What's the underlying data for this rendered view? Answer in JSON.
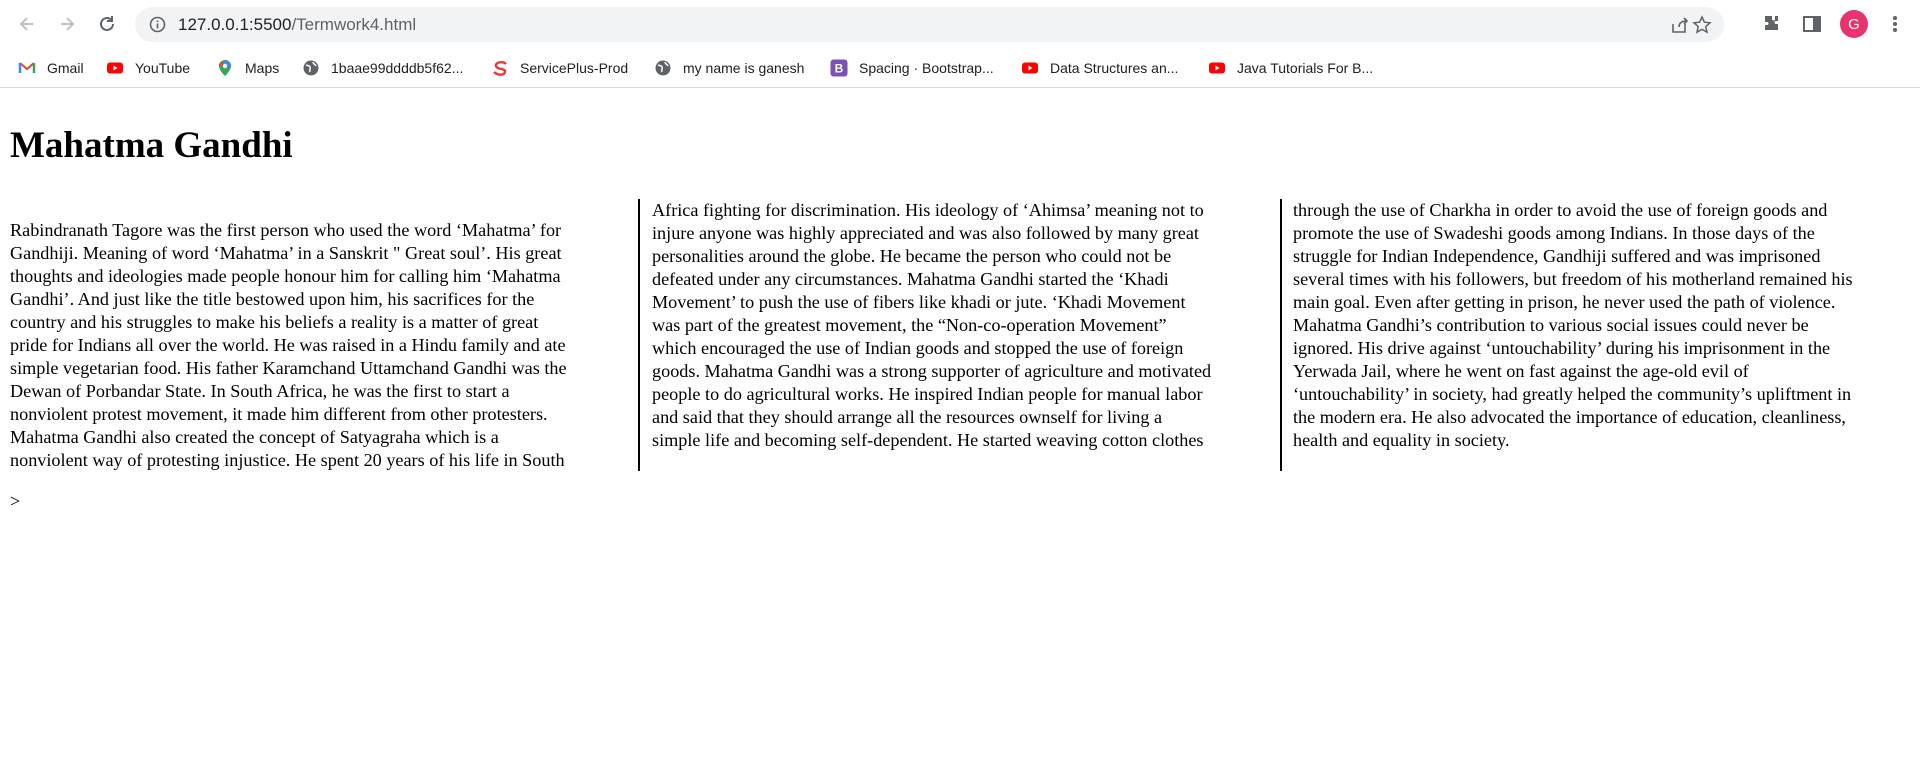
{
  "browser": {
    "url_host": "127.0.0.1:5500",
    "url_path": "/Termwork4.html",
    "avatar_letter": "G",
    "avatar_color": "#e8336d",
    "bookmarks": [
      {
        "label": "Gmail",
        "icon": "gmail-icon"
      },
      {
        "label": "YouTube",
        "icon": "youtube-icon"
      },
      {
        "label": "Maps",
        "icon": "maps-icon"
      },
      {
        "label": "1baae99ddddb5f62...",
        "icon": "globe-icon"
      },
      {
        "label": "ServicePlus-Prod",
        "icon": "serviceplus-icon"
      },
      {
        "label": "my name is ganesh",
        "icon": "globe-icon"
      },
      {
        "label": "Spacing · Bootstrap...",
        "icon": "bootstrap-icon"
      },
      {
        "label": "Data Structures an...",
        "icon": "youtube-icon"
      },
      {
        "label": "Java Tutorials For B...",
        "icon": "youtube-icon"
      }
    ]
  },
  "page": {
    "title": "Mahatma Gandhi",
    "columns": [
      [
        "Rabindranath Tagore was the first person who used the word  ‘Mahatma’ for",
        "Gandhiji. Meaning of word ‘Mahatma’ in a Sanskrit \" Great soul’. His great",
        "thoughts and ideologies made people honour him for calling him ‘Mahatma",
        "Gandhi’. And just like the title bestowed upon him, his sacrifices for the",
        "country and his struggles to make his beliefs a reality is a matter of great",
        "pride for Indians all over the world. He was raised in a Hindu family and ate",
        "simple vegetarian food. His father Karamchand Uttamchand Gandhi was the",
        "Dewan of Porbandar State. In South Africa, he was the first to start a",
        "nonviolent protest movement, it made him different from other protesters.",
        "Mahatma Gandhi also created the concept of Satyagraha which is a",
        "nonviolent way of protesting injustice. He spent 20 years of his life in South"
      ],
      [
        "Africa fighting for discrimination. His ideology of ‘Ahimsa’ meaning not to",
        "injure anyone was highly appreciated and was also followed by many great",
        "personalities around the globe. He became the person who could not be",
        "defeated under any circumstances. Mahatma Gandhi started the ‘Khadi",
        "Movement’ to push the use of fibers like khadi or jute. ‘Khadi Movement",
        "was part of the greatest movement, the “Non-co-operation Movement”",
        "which encouraged the use of Indian goods and stopped the use of foreign",
        "goods. Mahatma Gandhi was a strong supporter of agriculture and motivated",
        "people to do agricultural works. He inspired Indian people for manual labor",
        "and said that they should arrange all the resources ownself for living a",
        "simple life and becoming self-dependent. He started weaving cotton clothes"
      ],
      [
        "through the use of Charkha in order to avoid the use of foreign goods and",
        "promote the use of Swadeshi goods among Indians. In those days of the",
        "struggle for Indian Independence, Gandhiji suffered and was imprisoned",
        "several times with his followers, but freedom of his motherland remained his",
        "main goal. Even after getting in prison, he never used the path of violence.",
        "Mahatma Gandhi’s contribution to various social issues could never be",
        "ignored. His drive against ‘untouchability’ during his imprisonment in the",
        "Yerwada Jail, where he went on fast against the age-old evil of",
        "‘untouchability’ in society, had greatly helped the community’s upliftment in",
        "the modern era. He also advocated the importance of education, cleanliness,",
        "health and equality in society."
      ]
    ],
    "stray_text": ">"
  }
}
